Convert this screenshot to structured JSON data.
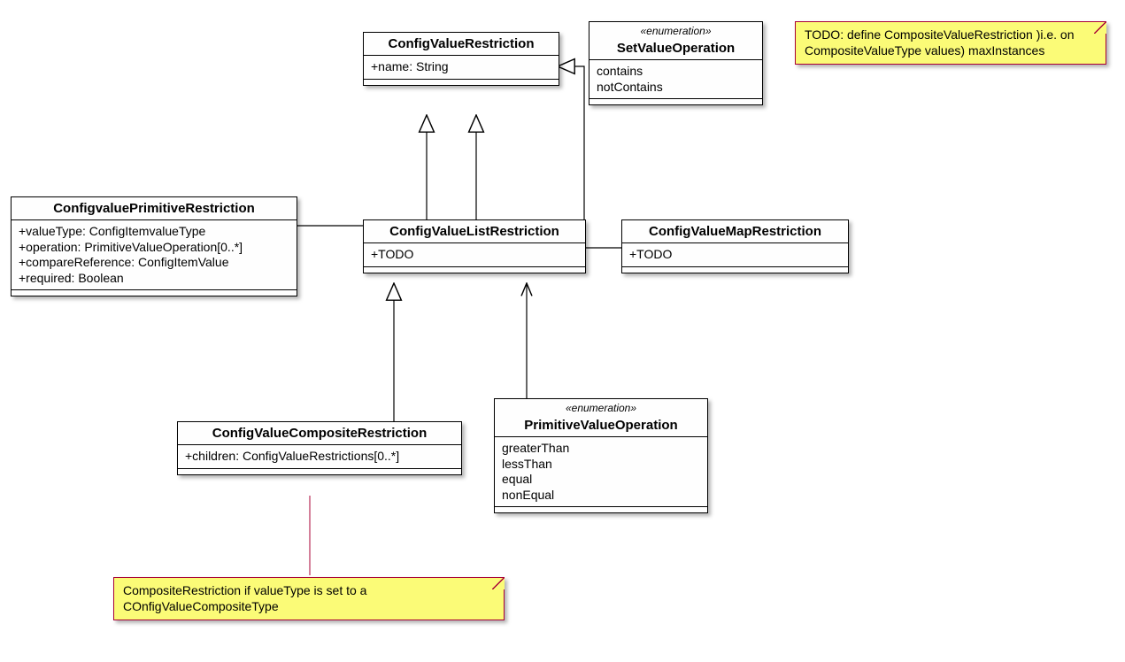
{
  "classes": {
    "ConfigValueRestriction": {
      "name": "ConfigValueRestriction",
      "attrs": [
        "+name: String"
      ]
    },
    "SetValueOperation": {
      "stereo": "«enumeration»",
      "name": "SetValueOperation",
      "attrs": [
        "contains",
        "notContains"
      ]
    },
    "ConfigvaluePrimitiveRestriction": {
      "name": "ConfigvaluePrimitiveRestriction",
      "attrs": [
        "+valueType: ConfigItemvalueType",
        "+operation: PrimitiveValueOperation[0..*]",
        "+compareReference: ConfigItemValue",
        "+required: Boolean"
      ]
    },
    "ConfigValueListRestriction": {
      "name": "ConfigValueListRestriction",
      "attrs": [
        "+TODO"
      ]
    },
    "ConfigValueMapRestriction": {
      "name": "ConfigValueMapRestriction",
      "attrs": [
        "+TODO"
      ]
    },
    "ConfigValueCompositeRestriction": {
      "name": "ConfigValueCompositeRestriction",
      "attrs": [
        "+children: ConfigValueRestrictions[0..*]"
      ]
    },
    "PrimitiveValueOperation": {
      "stereo": "«enumeration»",
      "name": "PrimitiveValueOperation",
      "attrs": [
        "greaterThan",
        "lessThan",
        "equal",
        "nonEqual"
      ]
    }
  },
  "notes": {
    "todo": "TODO: define CompositeValueRestriction )i.e. on CompositeValueType values) maxInstances",
    "composite": "CompositeRestriction if valueType is set to a COnfigValueCompositeType"
  }
}
